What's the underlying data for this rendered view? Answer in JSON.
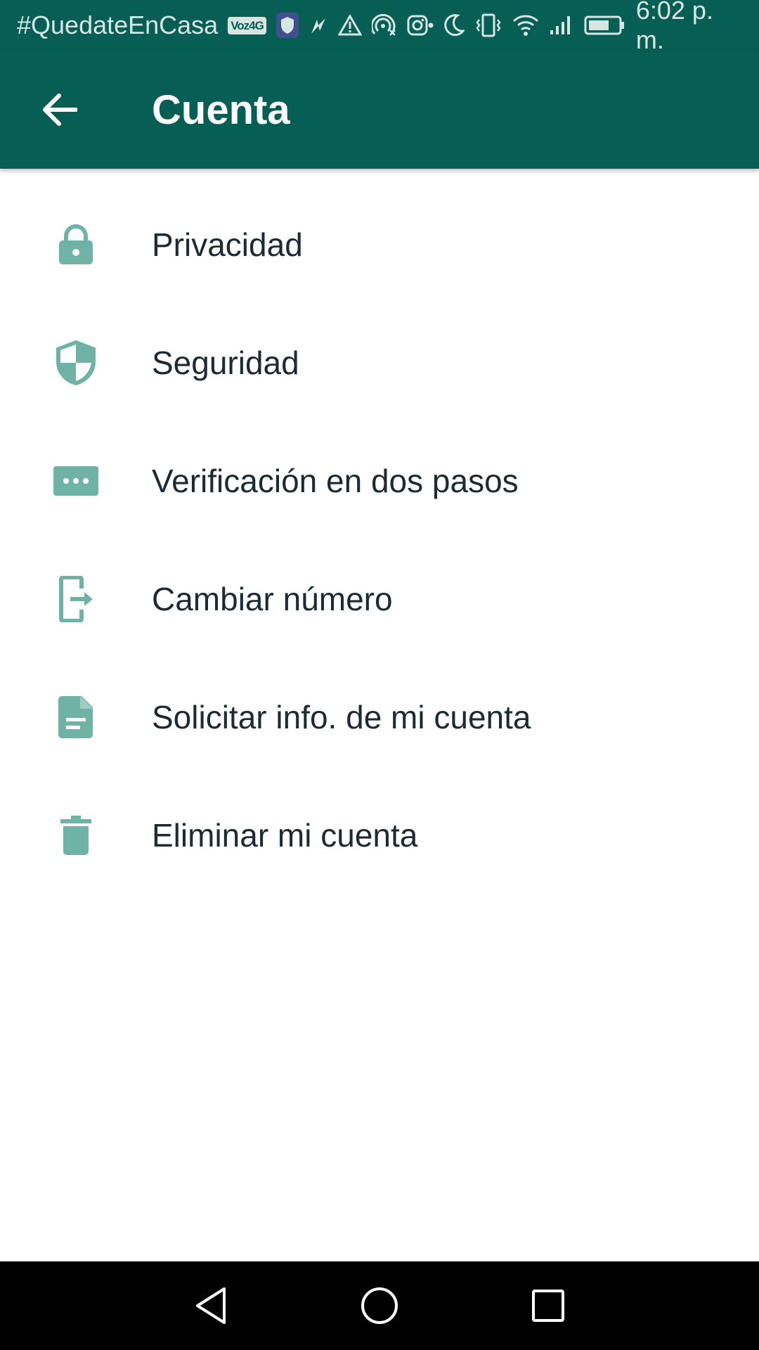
{
  "status_bar": {
    "carrier_text": "#QuedateEnCasa",
    "volte_label": "Voz4G",
    "time": "6:02 p. m.",
    "icons": [
      "volte-icon",
      "shield-app-icon",
      "location-arrow-icon",
      "warning-icon",
      "hotspot-icon",
      "instagram-icon",
      "dot-icon",
      "moon-icon",
      "vibrate-icon",
      "wifi-icon",
      "signal-icon",
      "battery-icon"
    ]
  },
  "app_bar": {
    "title": "Cuenta",
    "back_icon": "arrow-back-icon"
  },
  "menu": {
    "items": [
      {
        "label": "Privacidad",
        "icon": "lock-icon"
      },
      {
        "label": "Seguridad",
        "icon": "shield-icon"
      },
      {
        "label": "Verificación en dos pasos",
        "icon": "password-dots-icon"
      },
      {
        "label": "Cambiar número",
        "icon": "phone-change-icon"
      },
      {
        "label": "Solicitar info. de mi cuenta",
        "icon": "document-icon"
      },
      {
        "label": "Eliminar mi cuenta",
        "icon": "trash-icon"
      }
    ]
  },
  "nav_bar": {
    "buttons": [
      "back-triangle-icon",
      "home-circle-icon",
      "recents-square-icon"
    ]
  },
  "colors": {
    "primary": "#075e54",
    "icon_accent": "#6fb3a7",
    "text": "#1c2b33",
    "status_text": "#d7e6e3"
  }
}
